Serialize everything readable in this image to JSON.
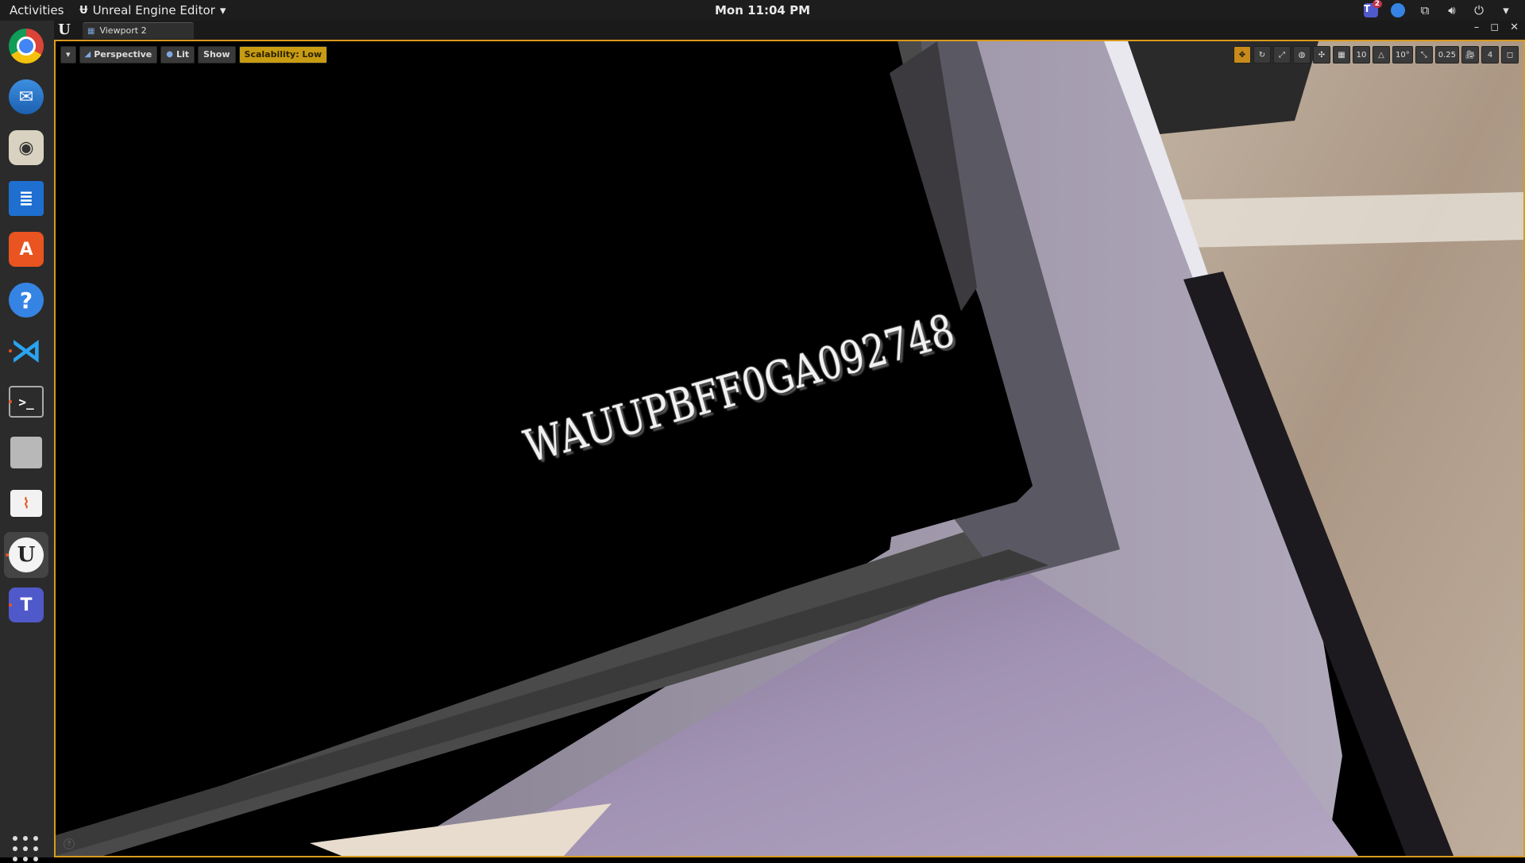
{
  "topbar": {
    "activities": "Activities",
    "app_name": "Unreal Engine Editor",
    "app_icon": "u-logo-icon",
    "clock": "Mon 11:04 PM",
    "tray": {
      "teams_badge": "2",
      "icons": [
        "teams-icon",
        "globe-icon",
        "network-icon",
        "volume-icon",
        "power-icon",
        "chevron-down-icon"
      ]
    }
  },
  "dock": {
    "apps": [
      "Google Chrome",
      "Thunderbird Mail",
      "Rhythmbox",
      "LibreOffice Writer",
      "Ubuntu Software",
      "Help",
      "Visual Studio Code",
      "Terminal",
      "Files",
      "System Monitor",
      "Unreal Engine",
      "Microsoft Teams"
    ],
    "show_apps_label": "Show Applications"
  },
  "ue": {
    "tab_label": "Viewport 2",
    "window_buttons": [
      "–",
      "◻",
      "✕"
    ],
    "toolbar": {
      "menu_arrow": "▾",
      "perspective": "Perspective",
      "lit": "Lit",
      "show": "Show",
      "scalability": "Scalability: Low",
      "grid_snap": "10",
      "rot_snap": "10°",
      "scale_snap": "0.25",
      "camera_speed": "4"
    },
    "plate_text": "WAUUPBFF0GA092748"
  },
  "colors": {
    "accent_border": "#d99a1c",
    "scalability_bg": "#c89c12",
    "purple_floor": "#a89bb8",
    "ground": "#b9a696"
  }
}
